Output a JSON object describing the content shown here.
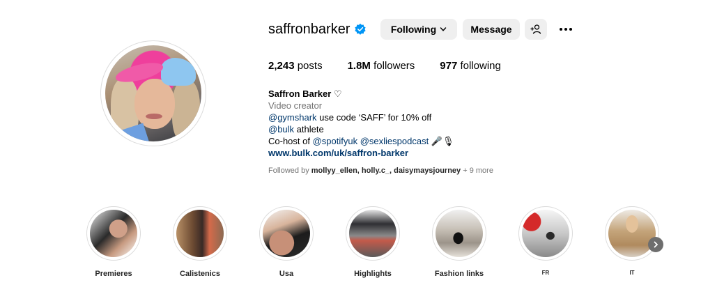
{
  "profile": {
    "username": "saffronbarker",
    "verified": true,
    "buttons": {
      "following": "Following",
      "message": "Message"
    },
    "stats": {
      "posts_count": "2,243",
      "posts_label": "posts",
      "followers_count": "1.8M",
      "followers_label": "followers",
      "following_count": "977",
      "following_label": "following"
    },
    "bio": {
      "name": "Saffron Barker ♡",
      "category": "Video creator",
      "line1_mention": "@gymshark",
      "line1_rest": " use code ‘SAFF’ for 10% off",
      "line2_mention": "@bulk",
      "line2_rest": " athlete",
      "line3_prefix": "Co-host of ",
      "line3_mention1": "@spotifyuk",
      "line3_space": " ",
      "line3_mention2": "@sexliespodcast",
      "line3_emoji": " 🎤🎙",
      "link": "www.bulk.com/uk/saffron-barker"
    },
    "followed_by": {
      "prefix": "Followed by ",
      "names": "mollyy_ellen, holly.c_, daisymaysjourney",
      "suffix": " + 9 more"
    }
  },
  "highlights": [
    {
      "label": "Premieres"
    },
    {
      "label": "Calistenics"
    },
    {
      "label": "Usa"
    },
    {
      "label": "Highlights"
    },
    {
      "label": "Fashion links"
    },
    {
      "label": "FR"
    },
    {
      "label": "IT"
    }
  ],
  "icons": {
    "verified": "verified-badge-icon",
    "chevron": "chevron-down-icon",
    "add_user": "add-user-icon",
    "more": "more-options-icon",
    "next": "chevron-right-icon"
  },
  "colors": {
    "verified_blue": "#0095f6",
    "link_blue": "#00376b",
    "button_gray": "#efefef",
    "secondary_text": "#737373"
  }
}
